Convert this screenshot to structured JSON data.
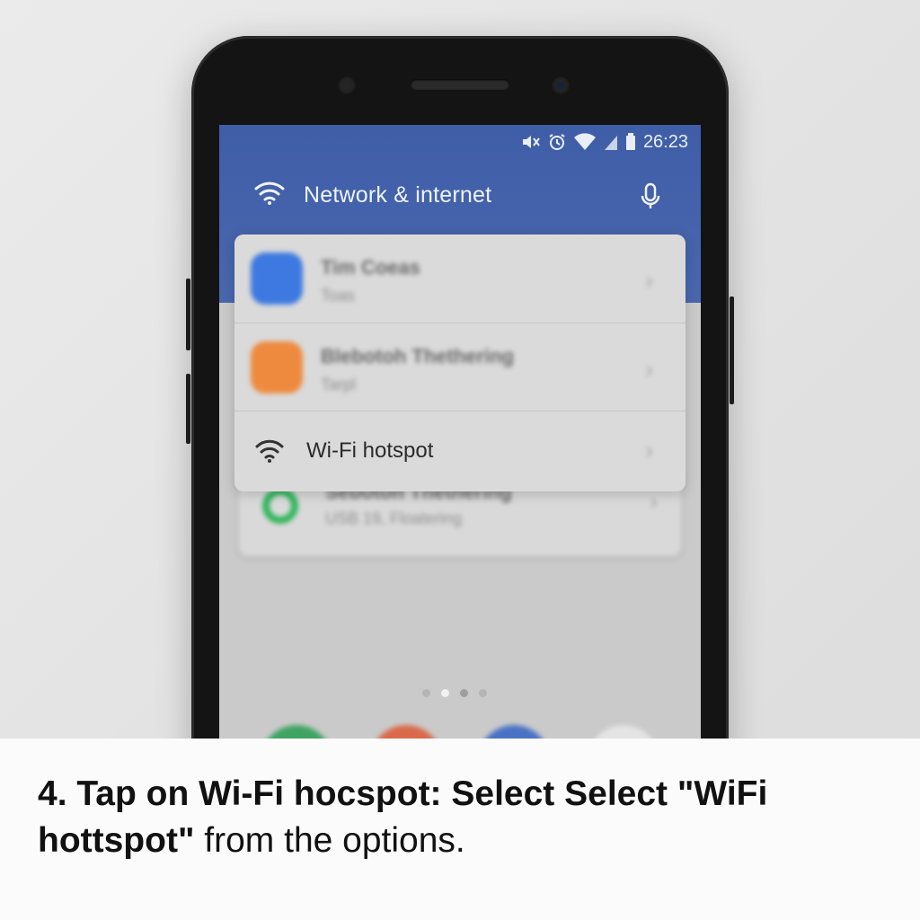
{
  "status_bar": {
    "time": "26:23"
  },
  "header": {
    "title": "Network & internet"
  },
  "menu": {
    "rows": [
      {
        "title": "Tim Coeas",
        "subtitle": "Toas"
      },
      {
        "title": "Blebotoh Thethering",
        "subtitle": "Tarpl"
      },
      {
        "title": "Wi-Fi hotspot"
      }
    ],
    "back_row": {
      "title": "Sebotoh Thethering",
      "subtitle": "USB 19, Floatering"
    }
  },
  "caption": {
    "bold_part": "4. Tap on Wi-Fi hocspot: Select Select \"WiFi hottspot\"",
    "regular_part": " from the options."
  },
  "colors": {
    "header_blue": "#4562aa",
    "icon_blue": "#3d79e0",
    "icon_orange": "#ee8a3e",
    "icon_green": "#2fb65a",
    "dock_green": "#3fa462",
    "dock_red": "#d9694a",
    "dock_blue": "#4a72c4"
  },
  "icons": [
    "wifi-icon",
    "mic-icon",
    "mute-icon",
    "alarm-icon",
    "signal-icon",
    "battery-icon",
    "chevron-right-icon",
    "whatsapp-icon"
  ]
}
